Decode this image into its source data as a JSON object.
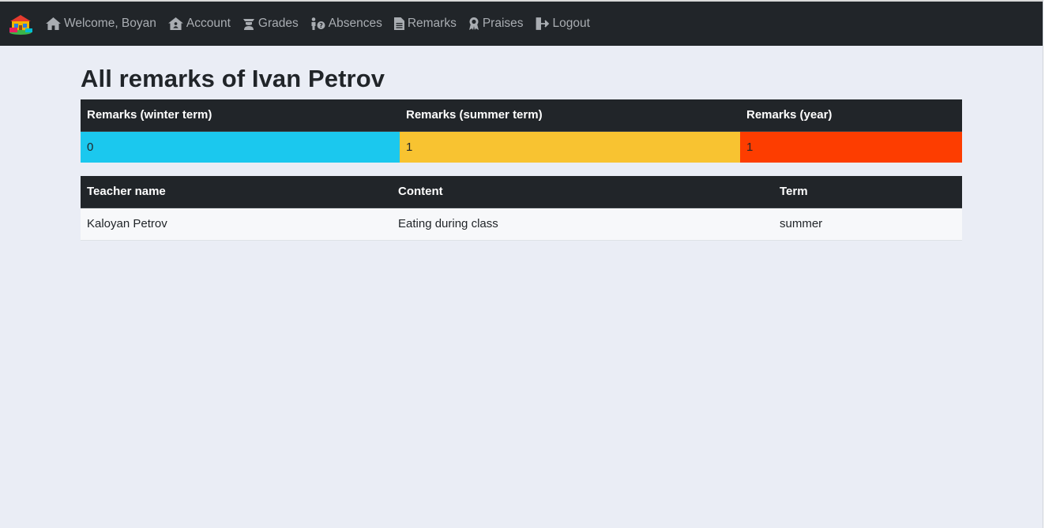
{
  "nav": {
    "items": [
      {
        "label": "Welcome, Boyan",
        "icon": "home-icon"
      },
      {
        "label": "Account",
        "icon": "account-home-icon"
      },
      {
        "label": "Grades",
        "icon": "graduation-cap-icon"
      },
      {
        "label": "Absences",
        "icon": "person-question-icon"
      },
      {
        "label": "Remarks",
        "icon": "document-icon"
      },
      {
        "label": "Praises",
        "icon": "award-icon"
      },
      {
        "label": "Logout",
        "icon": "logout-icon"
      }
    ]
  },
  "page_title": "All remarks of Ivan Petrov",
  "summary": {
    "headers": [
      "Remarks (winter term)",
      "Remarks (summer term)",
      "Remarks (year)"
    ],
    "values": [
      "0",
      "1",
      "1"
    ],
    "colors": [
      "#1bc8ee",
      "#f8c331",
      "#fd3d00"
    ]
  },
  "remarks_table": {
    "headers": [
      "Teacher name",
      "Content",
      "Term"
    ],
    "rows": [
      [
        "Kaloyan Petrov",
        "Eating during class",
        "summer"
      ]
    ]
  }
}
